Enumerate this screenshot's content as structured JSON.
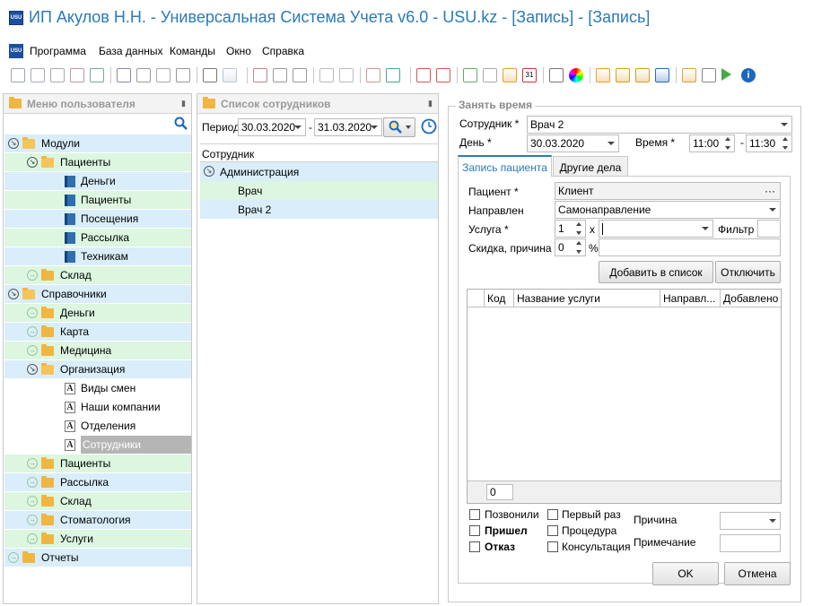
{
  "window": {
    "title": "ИП Акулов Н.Н. - Универсальная Система Учета v6.0 - USU.kz - [Запись] - [Запись]",
    "app_icon": "USU"
  },
  "menu": [
    "Программа",
    "База данных",
    "Команды",
    "Окно",
    "Справка"
  ],
  "toolbar": {
    "icons": [
      "new-icon",
      "copy-icon",
      "edit-icon",
      "delete-icon",
      "refresh-icon",
      "search-icon",
      "filter-icon",
      "filter-clear-icon",
      "filter-settings-icon",
      "flag-icon",
      "image-icon",
      "columns-icon",
      "expand-icon",
      "collapse-icon",
      "insert-icon",
      "note-icon",
      "export-icon",
      "excel-icon",
      "window-new-icon",
      "window-icon",
      "exit-icon",
      "clock-icon",
      "location-icon",
      "calendar-icon",
      "settings-icon",
      "color-icon",
      "rss-icon",
      "lock-icon",
      "users-icon",
      "pen-icon",
      "table-icon",
      "print-icon",
      "play-icon",
      "info-icon"
    ],
    "calendar_day": "31"
  },
  "left_panel": {
    "title": "Меню пользователя",
    "items": [
      {
        "label": "Модули",
        "icon": "folder-open",
        "level": 0,
        "row": "blue",
        "exp": "open"
      },
      {
        "label": "Пациенты",
        "icon": "folder-open",
        "level": 1,
        "row": "green",
        "exp": "open"
      },
      {
        "label": "Деньги",
        "icon": "book",
        "level": 2,
        "row": "blue"
      },
      {
        "label": "Пациенты",
        "icon": "book",
        "level": 2,
        "row": "green"
      },
      {
        "label": "Посещения",
        "icon": "book",
        "level": 2,
        "row": "blue"
      },
      {
        "label": "Рассылка",
        "icon": "book",
        "level": 2,
        "row": "green"
      },
      {
        "label": "Техникам",
        "icon": "book",
        "level": 2,
        "row": "blue"
      },
      {
        "label": "Склад",
        "icon": "folder",
        "level": 1,
        "row": "green",
        "exp": "closed"
      },
      {
        "label": "Справочники",
        "icon": "folder-open",
        "level": 0,
        "row": "blue",
        "exp": "open"
      },
      {
        "label": "Деньги",
        "icon": "folder",
        "level": 1,
        "row": "green",
        "exp": "closed"
      },
      {
        "label": "Карта",
        "icon": "folder",
        "level": 1,
        "row": "blue",
        "exp": "closed"
      },
      {
        "label": "Медицина",
        "icon": "folder",
        "level": 1,
        "row": "green",
        "exp": "closed"
      },
      {
        "label": "Организация",
        "icon": "folder-open",
        "level": 1,
        "row": "blue",
        "exp": "open"
      },
      {
        "label": "Виды смен",
        "icon": "a",
        "level": 2,
        "row": "white"
      },
      {
        "label": "Наши компании",
        "icon": "a",
        "level": 2,
        "row": "white"
      },
      {
        "label": "Отделения",
        "icon": "a",
        "level": 2,
        "row": "white"
      },
      {
        "label": "Сотрудники",
        "icon": "a",
        "level": 2,
        "row": "selected"
      },
      {
        "label": "Пациенты",
        "icon": "folder",
        "level": 1,
        "row": "green",
        "exp": "closed"
      },
      {
        "label": "Рассылка",
        "icon": "folder",
        "level": 1,
        "row": "blue",
        "exp": "closed"
      },
      {
        "label": "Склад",
        "icon": "folder",
        "level": 1,
        "row": "green",
        "exp": "closed"
      },
      {
        "label": "Стоматология",
        "icon": "folder",
        "level": 1,
        "row": "blue",
        "exp": "closed"
      },
      {
        "label": "Услуги",
        "icon": "folder",
        "level": 1,
        "row": "green",
        "exp": "closed"
      },
      {
        "label": "Отчеты",
        "icon": "folder",
        "level": 0,
        "row": "blue",
        "exp": "closed"
      }
    ]
  },
  "mid_panel": {
    "title": "Список сотрудников",
    "period_label": "Период",
    "date_from": "30.03.2020",
    "dash": "-",
    "date_to": "31.03.2020",
    "column": "Сотрудник",
    "group": "Администрация",
    "rows": [
      "Врач",
      "Врач 2"
    ]
  },
  "form": {
    "group_title": "Занять время",
    "employee_label": "Сотрудник *",
    "employee_value": "Врач 2",
    "day_label": "День *",
    "day_value": "30.03.2020",
    "time_label": "Время *",
    "time_from": "11:00",
    "time_dash": "-",
    "time_to": "11:30",
    "tabs": [
      "Запись пациента",
      "Другие дела"
    ],
    "patient_label": "Пациент *",
    "patient_value": "Клиент",
    "patient_button": "···",
    "referral_label": "Направлен",
    "referral_value": "Самонаправление",
    "service_label": "Услуга *",
    "service_qty": "1",
    "service_x": "x",
    "service_value": "",
    "filter_label": "Фильтр",
    "discount_label": "Скидка, причина",
    "discount_value": "0",
    "percent": "%",
    "add_button": "Добавить в список",
    "disable_button": "Отключить",
    "grid_columns": [
      "Код",
      "Название услуги",
      "Направл...",
      "Добавлено"
    ],
    "grid_total": "0",
    "checks": [
      "Позвонили",
      "Пришел",
      "Отказ",
      "Первый раз",
      "Процедура",
      "Консультация"
    ],
    "reason_label": "Причина",
    "note_label": "Примечание",
    "ok_button": "OK",
    "cancel_button": "Отмена"
  }
}
